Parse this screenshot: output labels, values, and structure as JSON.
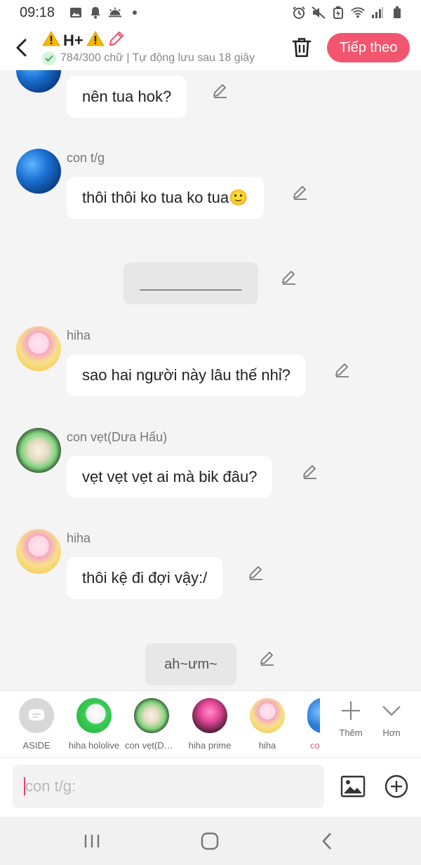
{
  "status_bar": {
    "time": "09:18"
  },
  "header": {
    "title_text": "H+",
    "subtitle": "784/300 chữ | Tự động lưu sau 18 giây",
    "next_label": "Tiếp theo"
  },
  "messages": {
    "m0": {
      "text": "nên tua hok?"
    },
    "m1": {
      "sender": "con t/g",
      "text": "thôi thôi ko tua ko tua🙂"
    },
    "m2": {
      "text": "_____________"
    },
    "m3": {
      "sender": "hiha",
      "text": "sao hai người này lâu thế nhỉ?"
    },
    "m4": {
      "sender": "con vẹt(Dưa Hấu)",
      "text": "vẹt vẹt vẹt ai mà bik đâu?"
    },
    "m5": {
      "sender": "hiha",
      "text": "thôi kệ đi đợi vậy:/"
    },
    "m6": {
      "text": "ah~ưm~"
    }
  },
  "characters": {
    "aside": "ASIDE",
    "c1": "hiha hololive",
    "c2": "con vẹt(Dưa Hấu)",
    "c3": "hiha prime",
    "c4": "hiha",
    "c5": "con t/g"
  },
  "tools": {
    "add_label": "Thêm",
    "more_label": "Hơn"
  },
  "composer": {
    "placeholder": "con t/g:"
  },
  "colors": {
    "accent": "#f2566e",
    "bg": "#f4f4f4"
  }
}
